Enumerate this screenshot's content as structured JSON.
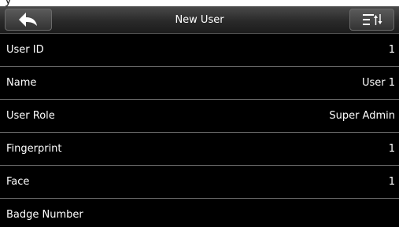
{
  "header": {
    "title": "New User",
    "back_icon": "back-arrow-icon",
    "sort_icon": "sort-menu-icon",
    "header_color": "#2a2a2a",
    "accent_color": "#ffffff"
  },
  "fields": [
    {
      "label": "User ID",
      "value": "1"
    },
    {
      "label": "Name",
      "value": "User 1"
    },
    {
      "label": "User Role",
      "value": "Super Admin"
    },
    {
      "label": "Fingerprint",
      "value": "1"
    },
    {
      "label": "Face",
      "value": "1"
    },
    {
      "label": "Badge Number",
      "value": ""
    }
  ]
}
